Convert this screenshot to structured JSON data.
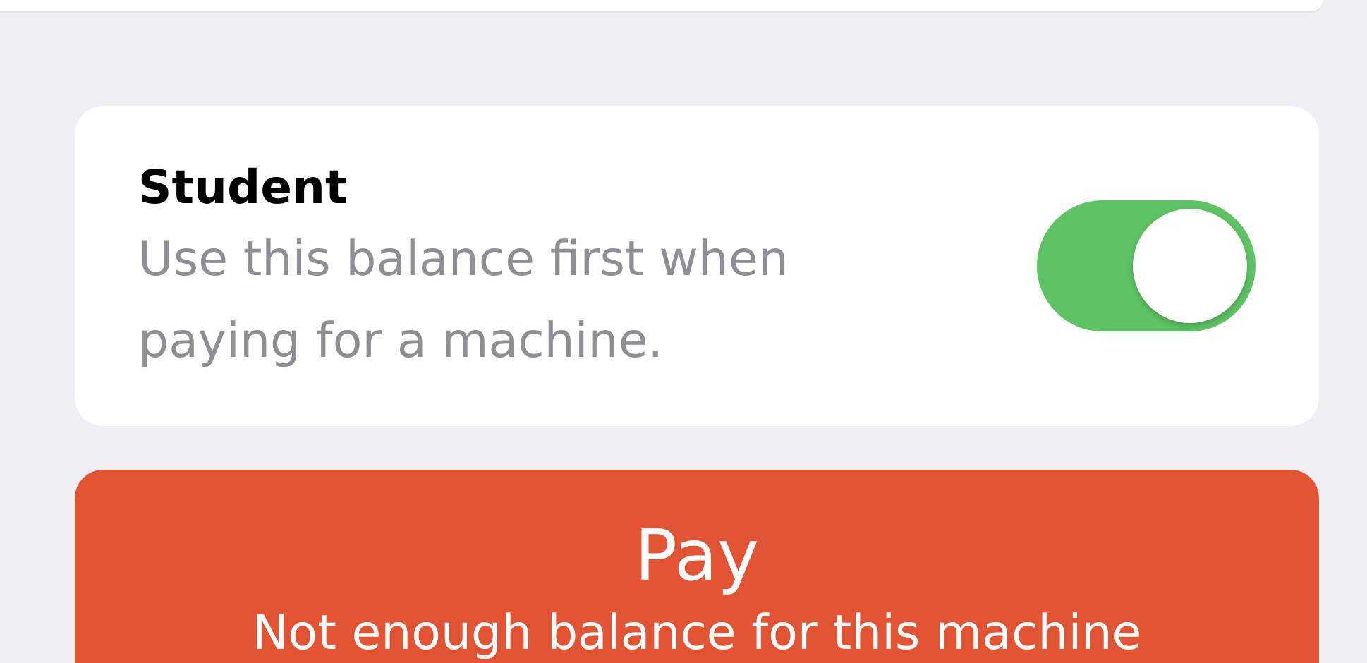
{
  "balance_option": {
    "title": "Student",
    "description": "Use this balance first when paying for a machine.",
    "on": true
  },
  "pay_button": {
    "label": "Pay",
    "note": "Not enough balance for this machine"
  }
}
